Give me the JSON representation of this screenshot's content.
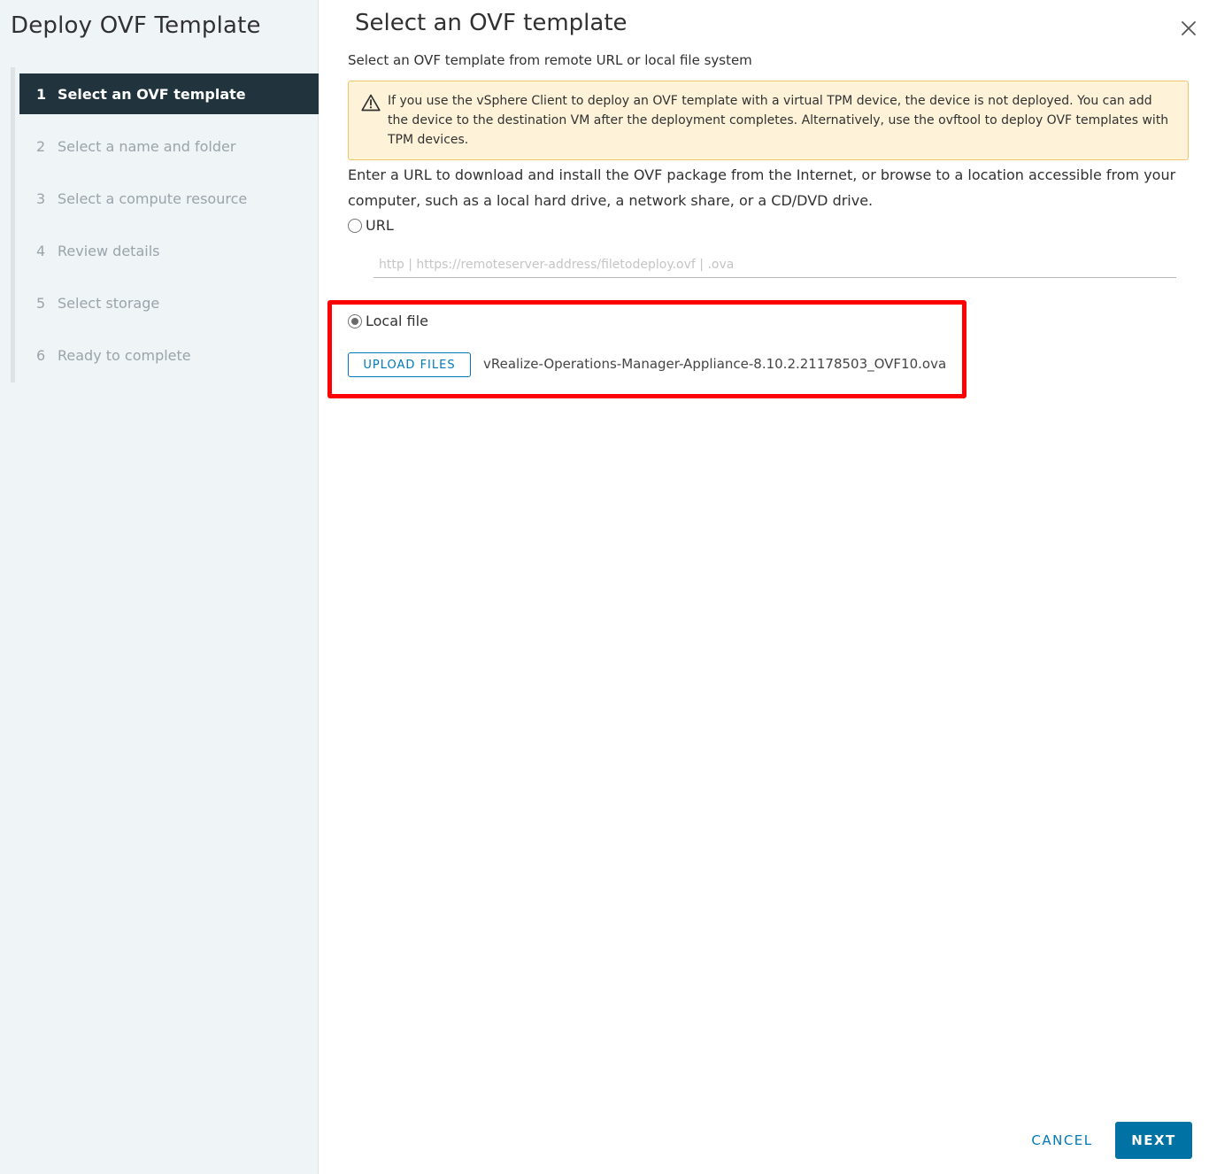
{
  "nav": {
    "title": "Deploy OVF Template",
    "steps": [
      {
        "num": "1",
        "label": "Select an OVF template",
        "active": true
      },
      {
        "num": "2",
        "label": "Select a name and folder",
        "active": false
      },
      {
        "num": "3",
        "label": "Select a compute resource",
        "active": false
      },
      {
        "num": "4",
        "label": "Review details",
        "active": false
      },
      {
        "num": "5",
        "label": "Select storage",
        "active": false
      },
      {
        "num": "6",
        "label": "Ready to complete",
        "active": false
      }
    ]
  },
  "main": {
    "title": "Select an OVF template",
    "subtitle": "Select an OVF template from remote URL or local file system",
    "alert_text": "If you use the vSphere Client to deploy an OVF template with a virtual TPM device, the device is not deployed. You can add the device to the destination VM after the deployment completes. Alternatively, use the ovftool to deploy OVF templates with TPM devices.",
    "intro": "Enter a URL to download and install the OVF package from the Internet, or browse to a location accessible from your computer, such as a local hard drive, a network share, or a CD/DVD drive.",
    "url_option": {
      "label": "URL",
      "selected": false
    },
    "url_input": {
      "value": "",
      "placeholder": "http | https://remoteserver-address/filetodeploy.ovf | .ova"
    },
    "local_option": {
      "label": "Local file",
      "selected": true
    },
    "upload_label": "UPLOAD FILES",
    "filename": "vRealize-Operations-Manager-Appliance-8.10.2.21178503_OVF10.ova"
  },
  "footer": {
    "cancel_label": "CANCEL",
    "next_label": "NEXT"
  },
  "colors": {
    "accent": "#0079b8",
    "primary_button": "#0072a3",
    "active_step": "#21333d",
    "alert_bg": "#fef3d8",
    "alert_border": "#f2c56b",
    "highlight": "#ff0000"
  },
  "icons": {
    "close": "close-icon",
    "warning": "warning-icon"
  }
}
